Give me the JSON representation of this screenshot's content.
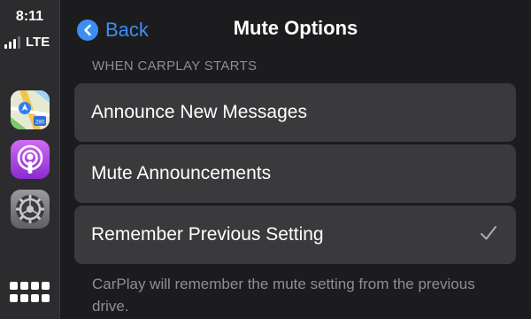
{
  "status": {
    "time": "8:11",
    "network": "LTE",
    "signal_bars_filled": 3,
    "signal_bars_total": 4
  },
  "sidebar": {
    "apps": [
      {
        "name": "Maps",
        "icon": "maps-icon"
      },
      {
        "name": "Podcasts",
        "icon": "podcasts-icon"
      },
      {
        "name": "Settings",
        "icon": "settings-gear-icon"
      }
    ],
    "dashboard_icon": "app-grid-icon"
  },
  "header": {
    "back_label": "Back",
    "title": "Mute Options"
  },
  "section": {
    "header": "WHEN CARPLAY STARTS",
    "options": [
      {
        "label": "Announce New Messages",
        "selected": false
      },
      {
        "label": "Mute Announcements",
        "selected": false
      },
      {
        "label": "Remember Previous Setting",
        "selected": true
      }
    ],
    "footer": "CarPlay will remember the mute setting from the previous drive."
  },
  "colors": {
    "background": "#1c1c1e",
    "sidebar": "#2c2c2e",
    "row": "#3a3a3c",
    "accent": "#3b8ff2",
    "secondary_text": "#8e8e93"
  }
}
